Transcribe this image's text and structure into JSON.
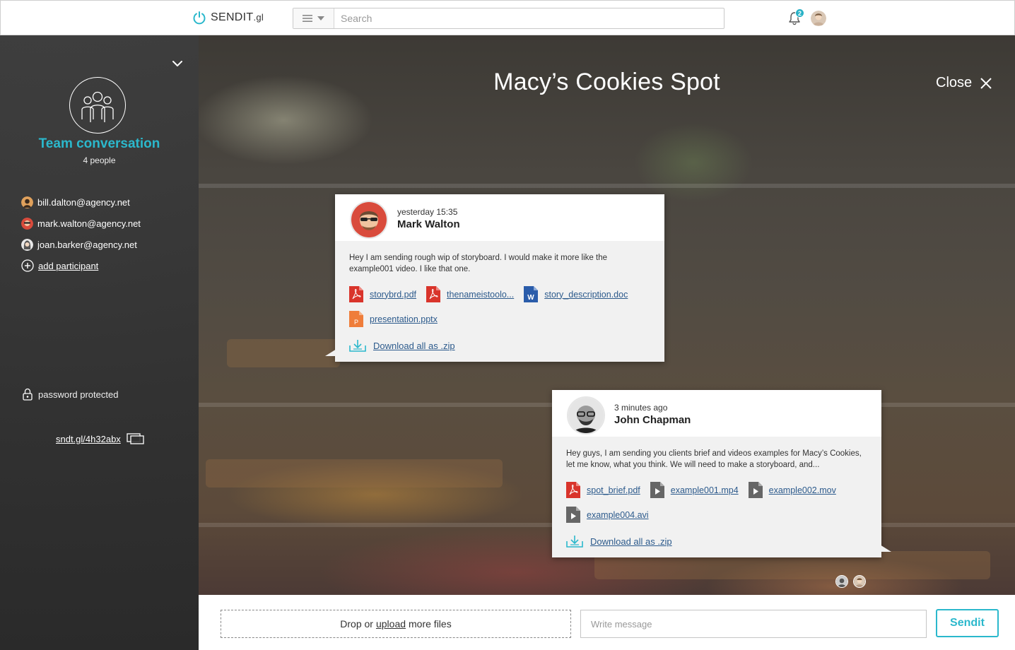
{
  "app": {
    "logo_text": "SENDIT",
    "logo_sub": ".gl"
  },
  "search": {
    "placeholder": "Search"
  },
  "notifications": {
    "count": "2"
  },
  "sidebar": {
    "team_title": "Team conversation",
    "people_count": "4 people",
    "participants": [
      {
        "email": "bill.dalton@agency.net"
      },
      {
        "email": "mark.walton@agency.net"
      },
      {
        "email": "joan.barker@agency.net"
      }
    ],
    "add_participant": "add participant",
    "password_label": "password protected",
    "short_link": "sndt.gl/4h32abx"
  },
  "conversation": {
    "title": "Macy’s Cookies Spot",
    "close_label": "Close"
  },
  "messages": [
    {
      "time": "yesterday 15:35",
      "author": "Mark Walton",
      "text": "Hey I am sending rough wip of storyboard. I would make it more like the example001 video. I like that one.",
      "files": [
        {
          "name": "storybrd.pdf",
          "type": "pdf"
        },
        {
          "name": "thenameistoolo...",
          "type": "pdf"
        },
        {
          "name": "story_description.doc",
          "type": "doc"
        },
        {
          "name": "presentation.pptx",
          "type": "pptx"
        }
      ],
      "download_label": "Download all as .zip"
    },
    {
      "time": "3 minutes ago",
      "author": "John Chapman",
      "text": "Hey guys, I am sending you clients brief and videos examples for Macy’s Cookies, let me know, what you think. We will need to make a storyboard, and...",
      "files": [
        {
          "name": "spot_brief.pdf",
          "type": "pdf"
        },
        {
          "name": "example001.mp4",
          "type": "video"
        },
        {
          "name": "example002.mov",
          "type": "video"
        },
        {
          "name": "example004.avi",
          "type": "video"
        }
      ],
      "download_label": "Download all as .zip"
    }
  ],
  "composer": {
    "drop_prefix": "Drop or",
    "drop_link": "upload",
    "drop_suffix": "more files",
    "message_placeholder": "Write message",
    "send_label": "Sendit"
  },
  "colors": {
    "accent": "#2bb8cc",
    "link": "#2c5a8c",
    "pdf": "#d9342b",
    "doc": "#2a5caa",
    "pptx": "#ef7d3a",
    "video": "#666666"
  }
}
